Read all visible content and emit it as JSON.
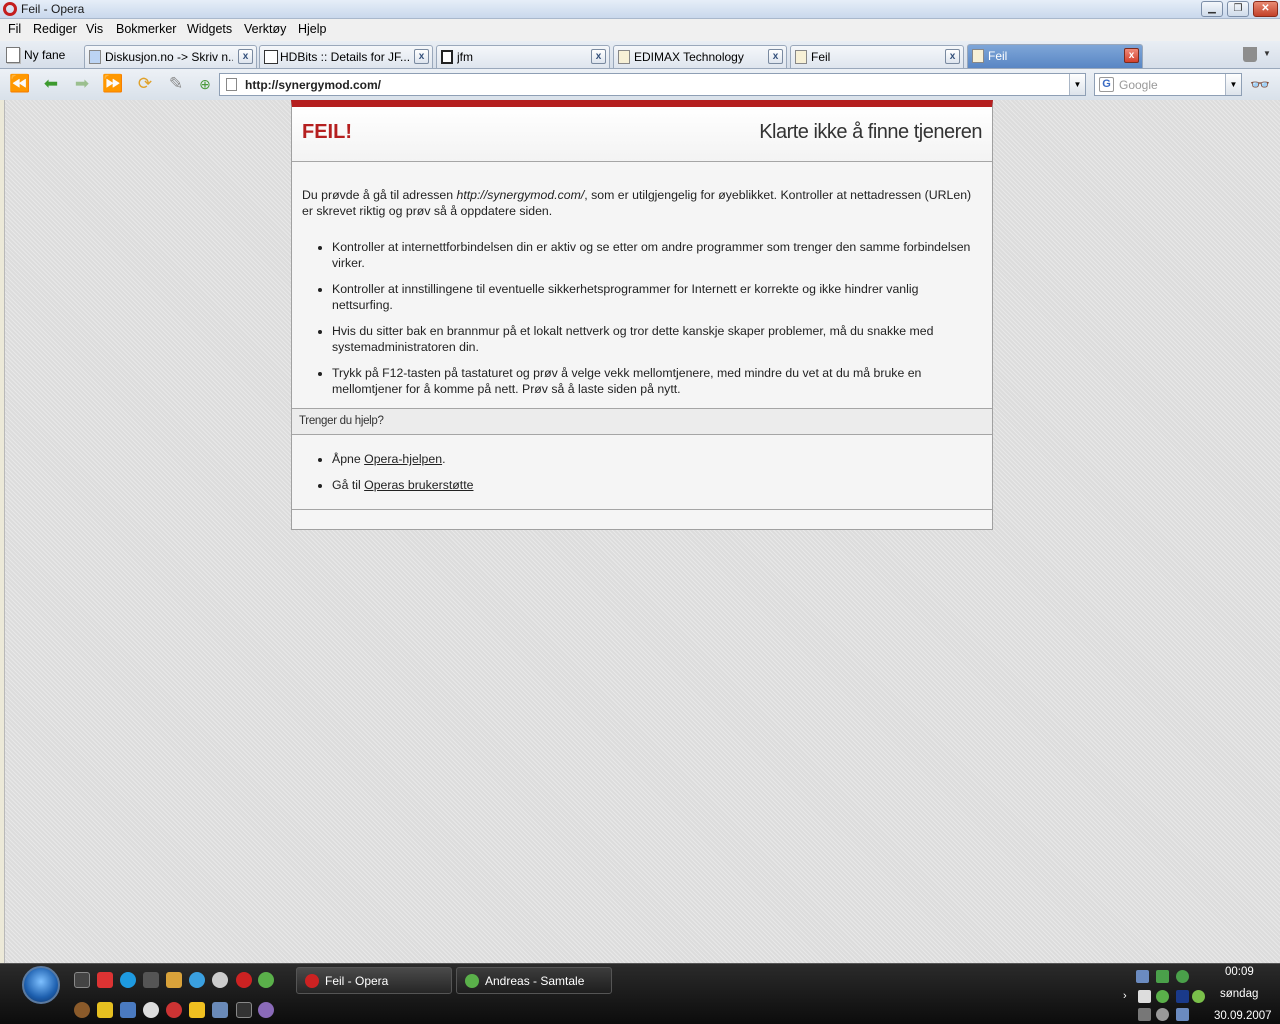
{
  "window": {
    "title": "Feil - Opera"
  },
  "menu": [
    "Fil",
    "Rediger",
    "Vis",
    "Bokmerker",
    "Widgets",
    "Verktøy",
    "Hjelp"
  ],
  "tabs": {
    "new_tab_label": "Ny fane",
    "items": [
      {
        "label": "Diskusjon.no -> Skriv n...",
        "active": false
      },
      {
        "label": "HDBits :: Details for JF......",
        "active": false
      },
      {
        "label": "jfm",
        "active": false
      },
      {
        "label": "EDIMAX Technology",
        "active": false
      },
      {
        "label": "Feil",
        "active": false
      },
      {
        "label": "Feil",
        "active": true
      }
    ]
  },
  "address": {
    "url": "http://synergymod.com/"
  },
  "search": {
    "placeholder": "Google"
  },
  "error_page": {
    "badge": "FEIL!",
    "headline": "Klarte ikke å finne tjeneren",
    "intro_before": "Du prøvde å gå til adressen ",
    "intro_url": "http://synergymod.com/",
    "intro_after": ", som er utilgjengelig for øyeblikket. Kontroller at nettadressen (URLen) er skrevet riktig og prøv så å oppdatere siden.",
    "tips": [
      "Kontroller at internettforbindelsen din er aktiv og se etter om andre programmer som trenger den samme forbindelsen virker.",
      "Kontroller at innstillingene til eventuelle sikkerhetsprogrammer for Internett er korrekte og ikke hindrer vanlig nettsurfing.",
      "Hvis du sitter bak en brannmur på et lokalt nettverk og tror dette kanskje skaper problemer, må du snakke med systemadministratoren din.",
      "Trykk på F12-tasten på tastaturet og prøv å velge vekk mellomtjenere, med mindre du vet at du må bruke en mellomtjener for å komme på nett. Prøv så å laste siden på nytt."
    ],
    "help_heading": "Trenger du hjelp?",
    "help_links": [
      {
        "prefix": "Åpne ",
        "link": "Opera-hjelpen",
        "suffix": "."
      },
      {
        "prefix": "Gå til ",
        "link": "Operas brukerstøtte",
        "suffix": ""
      }
    ]
  },
  "taskbar": {
    "buttons": [
      {
        "label": "Feil - Opera"
      },
      {
        "label": "Andreas - Samtale"
      }
    ],
    "clock": {
      "time": "00:09",
      "day": "søndag",
      "date": "30.09.2007"
    }
  },
  "icons": {
    "app": "opera-icon",
    "back": "rewind-icon",
    "prev": "back-arrow-icon",
    "next": "forward-arrow-icon",
    "fast_forward": "fast-forward-icon",
    "reload": "reload-icon",
    "edit": "pencil-icon",
    "bookmark": "add-bookmark-icon",
    "trash": "trash-icon",
    "glasses": "binoculars-icon"
  },
  "colors": {
    "accent_red": "#b51f1f",
    "active_tab": "#6b95cf"
  }
}
